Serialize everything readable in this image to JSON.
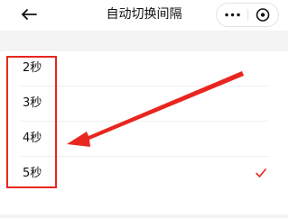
{
  "nav": {
    "title": "自动切换间隔",
    "back_icon": "back-arrow-icon",
    "more_icon": "more-dots-icon",
    "close_icon": "close-circle-icon"
  },
  "options": [
    {
      "label": "2秒",
      "selected": false
    },
    {
      "label": "3秒",
      "selected": false
    },
    {
      "label": "4秒",
      "selected": false
    },
    {
      "label": "5秒",
      "selected": true
    }
  ],
  "check_icon": "checkmark-icon",
  "colors": {
    "annotation": "#e8261f",
    "check": "#e8261f",
    "title_text": "#111111",
    "gap_background": "#f4f4f4"
  }
}
